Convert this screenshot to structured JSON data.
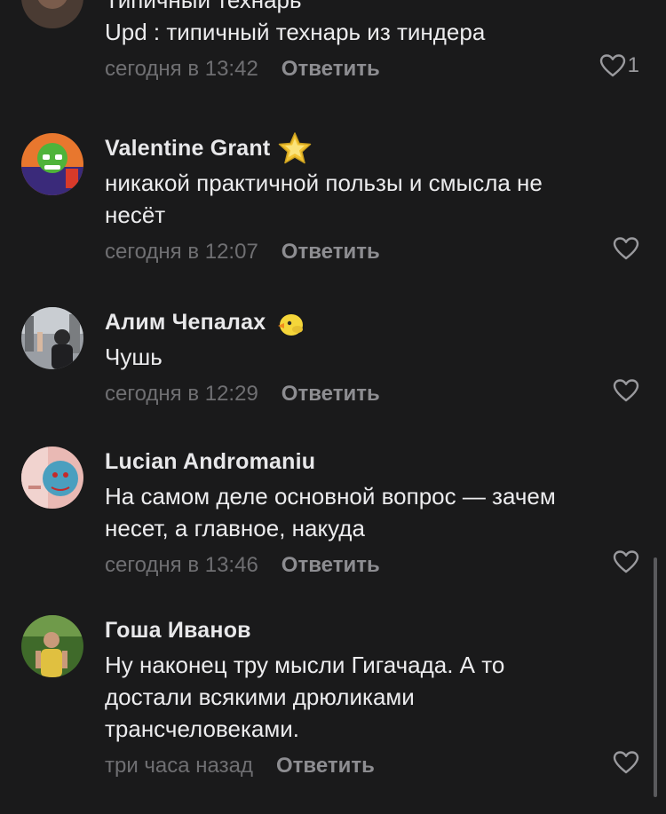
{
  "comments": [
    {
      "author": "",
      "text_lines": [
        "Типичный технарь",
        "Upd : типичный технарь из тиндера"
      ],
      "time": "сегодня в 13:42",
      "reply_label": "Ответить",
      "likes": "1"
    },
    {
      "author": "Valentine Grant",
      "badge": "star-icon",
      "text_lines": [
        "никакой практичной пользы и смысла не",
        "несёт"
      ],
      "time": "сегодня в 12:07",
      "reply_label": "Ответить",
      "likes": ""
    },
    {
      "author": "Алим Чепалах",
      "badge": "duck-icon",
      "text_lines": [
        "Чушь"
      ],
      "time": "сегодня в 12:29",
      "reply_label": "Ответить",
      "likes": ""
    },
    {
      "author": "Lucian Andromaniu",
      "text_lines": [
        "На самом деле основной вопрос — зачем",
        "несет, а главное, накуда"
      ],
      "time": "сегодня в 13:46",
      "reply_label": "Ответить",
      "likes": ""
    },
    {
      "author": "Гоша Иванов",
      "text_lines": [
        "Ну наконец тру мысли Гигачада. А то",
        "достали всякими дрюликами",
        "трансчеловеками."
      ],
      "time": "три часа назад",
      "reply_label": "Ответить",
      "likes": ""
    }
  ],
  "colors": {
    "background": "#1a1a1b",
    "text": "#ececee",
    "meta": "#6f6f72",
    "reply": "#8d8d91",
    "star": "#f2c230"
  }
}
